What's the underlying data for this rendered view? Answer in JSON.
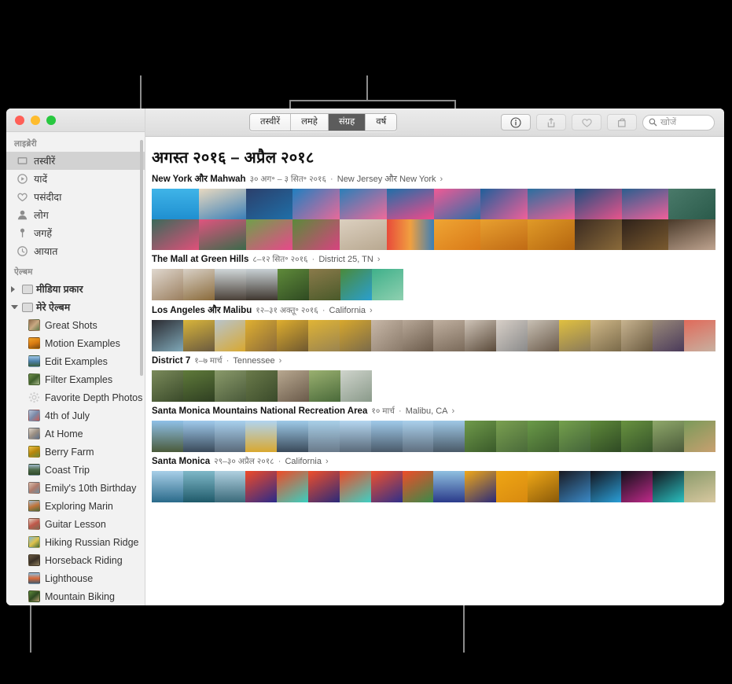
{
  "window": {
    "traffic_lights": [
      "close",
      "minimize",
      "zoom"
    ]
  },
  "sidebar": {
    "library_header": "लाइब्रेरी",
    "library_items": [
      {
        "label": "तस्वीरें",
        "icon": "photos-icon",
        "selected": true
      },
      {
        "label": "यादें",
        "icon": "memories-icon",
        "selected": false
      },
      {
        "label": "पसंदीदा",
        "icon": "heart-icon",
        "selected": false
      },
      {
        "label": "लोग",
        "icon": "person-icon",
        "selected": false
      },
      {
        "label": "जगहें",
        "icon": "pin-icon",
        "selected": false
      },
      {
        "label": "आयात",
        "icon": "clock-icon",
        "selected": false
      }
    ],
    "albums_header": "ऐल्बम",
    "groups": [
      {
        "label": "मीडिया प्रकार",
        "expanded": false
      },
      {
        "label": "मेरे ऐल्बम",
        "expanded": true
      }
    ],
    "albums": [
      {
        "label": "Great Shots",
        "thumb": "linear-gradient(135deg,#8d6b4c,#c9a882,#5e7a4a)"
      },
      {
        "label": "Motion Examples",
        "thumb": "linear-gradient(160deg,#f0a32b,#d97b12,#7a4a10)"
      },
      {
        "label": "Edit Examples",
        "thumb": "linear-gradient(180deg,#9fc6e8,#4a7fa8,#38603f)"
      },
      {
        "label": "Filter Examples",
        "thumb": "linear-gradient(140deg,#6f8f4a,#3f5f2c,#a8b88a)"
      },
      {
        "label": "Favorite Depth Photos",
        "thumb": "gear-icon"
      },
      {
        "label": "4th of July",
        "thumb": "linear-gradient(135deg,#b9c3d6,#7a8aa8,#c75b55)"
      },
      {
        "label": "At Home",
        "thumb": "linear-gradient(140deg,#dcd3c8,#9b8f82,#5c6f8a)"
      },
      {
        "label": "Berry Farm",
        "thumb": "linear-gradient(150deg,#e8c24a,#b8860b,#6d8a3a)"
      },
      {
        "label": "Coast Trip",
        "thumb": "linear-gradient(180deg,#9fb8c9,#4e6b4a,#2f4a2a)"
      },
      {
        "label": "Emily's 10th Birthday",
        "thumb": "linear-gradient(140deg,#d8c0b0,#b07a6a,#6f8f9f)"
      },
      {
        "label": "Exploring Marin",
        "thumb": "linear-gradient(160deg,#9fc2dc,#c1743a,#4a6a3a)"
      },
      {
        "label": "Guitar Lesson",
        "thumb": "linear-gradient(150deg,#e0d2c0,#c0584a,#7a6a52)"
      },
      {
        "label": "Hiking Russian Ridge",
        "thumb": "linear-gradient(140deg,#79b8e0,#e0c24a,#3f6a3a)"
      },
      {
        "label": "Horseback Riding",
        "thumb": "linear-gradient(150deg,#6b5a42,#3a3026,#8a7a5a)"
      },
      {
        "label": "Lighthouse",
        "thumb": "linear-gradient(180deg,#8fc0e0,#d96a3a,#4a5a6a)"
      },
      {
        "label": "Mountain Biking",
        "thumb": "linear-gradient(140deg,#5f8a3a,#2f4a22,#b8a070)"
      }
    ]
  },
  "toolbar": {
    "segments": [
      {
        "label": "तस्वीरें",
        "active": false
      },
      {
        "label": "लमहे",
        "active": false
      },
      {
        "label": "संग्रह",
        "active": true
      },
      {
        "label": "वर्ष",
        "active": false
      }
    ],
    "buttons": [
      {
        "name": "info-icon",
        "glyph": "ⓘ",
        "enabled": true
      },
      {
        "name": "share-icon",
        "glyph": "share",
        "enabled": false
      },
      {
        "name": "favorite-heart-icon",
        "glyph": "heart",
        "enabled": false
      },
      {
        "name": "rotate-icon",
        "glyph": "rotate",
        "enabled": false
      }
    ],
    "search_placeholder": "खोजें",
    "search_value": ""
  },
  "main": {
    "title": "अगस्त २०१६ – अप्रैल २०१८",
    "collections": [
      {
        "title": "New York और Mahwah",
        "date": "३० अग॰ – ३ सित॰ २०१६",
        "place": "New Jersey और New York",
        "rows": 2,
        "tiles": [
          "linear-gradient(180deg,#3fb4e8,#1f8fd0)",
          "linear-gradient(160deg,#e8d9c0,#3a7fb8)",
          "linear-gradient(150deg,#2b3f6b,#1f6fa8)",
          "linear-gradient(140deg,#1f7fc0,#e86a9a)",
          "linear-gradient(150deg,#2a7fb8,#f06a9a)",
          "linear-gradient(160deg,#1f6fa8,#f04a8a)",
          "linear-gradient(150deg,#f05a95,#2a6fa8)",
          "linear-gradient(140deg,#1f5f9a,#f0609a)",
          "linear-gradient(160deg,#2a6f9f,#ef5f95)",
          "linear-gradient(150deg,#1d4f7f,#e8548c)",
          "linear-gradient(160deg,#2b5f8f,#f0609a)",
          "linear-gradient(140deg,#4a7a6a,#2a5a4a)",
          "linear-gradient(150deg,#3a6a5a,#e0507a)",
          "linear-gradient(160deg,#e0547f,#3a6a4a)",
          "linear-gradient(150deg,#6fa04a,#e8488a)",
          "linear-gradient(140deg,#5a8a3a,#d8427f)",
          "linear-gradient(160deg,#dcd0c0,#b8a890)",
          "linear-gradient(90deg,#e84a3a,#f0a040,#3a7fb8)",
          "linear-gradient(150deg,#efa534,#d97a18)",
          "linear-gradient(160deg,#e8a030,#c06a14)",
          "linear-gradient(150deg,#e09a28,#b5660f)",
          "linear-gradient(140deg,#3a2a20,#8a6a3a)",
          "linear-gradient(150deg,#2e211a,#7a5a2f)",
          "linear-gradient(160deg,#4a3a2a,#bfa490)"
        ]
      },
      {
        "title": "The Mall at Green Hills",
        "date": "८–१२ सित॰ २०१६",
        "place": "District 25, TN",
        "rows": 1,
        "tiles": [
          "linear-gradient(150deg,#e0d8cf,#9b7f5f)",
          "linear-gradient(160deg,#d8d0c6,#8a6a3a)",
          "linear-gradient(180deg,#cfd6d8,#4a4038)",
          "linear-gradient(180deg,#c8d0d4,#3f372f)",
          "linear-gradient(150deg,#5f8a3a,#2f4a22)",
          "linear-gradient(160deg,#8a7a4a,#4a5a2a)",
          "linear-gradient(140deg,#4a8a3a,#2a9fd0)",
          "linear-gradient(150deg,#3fb08a,#8fd0b0)"
        ]
      },
      {
        "title": "Los Angeles और Malibu",
        "date": "१२–३१ अक्तू॰ २०१६",
        "place": "California",
        "rows": 1,
        "tiles": [
          "linear-gradient(150deg,#2a2a30,#7fa8b8)",
          "linear-gradient(160deg,#d8b43a,#6a5a40)",
          "linear-gradient(150deg,#b8c4cc,#d8a830)",
          "linear-gradient(140deg,#e0b030,#8a6a3a)",
          "linear-gradient(150deg,#dfae2e,#6f5830)",
          "linear-gradient(160deg,#e0b435,#9a8450)",
          "linear-gradient(150deg,#d8a82c,#7a6a4a)",
          "linear-gradient(140deg,#c8b8a8,#8a7a6a)",
          "linear-gradient(150deg,#b8a898,#6a5a4a)",
          "linear-gradient(160deg,#c0b0a0,#7a6a5a)",
          "linear-gradient(150deg,#cfc4b8,#5a4a3a)",
          "linear-gradient(140deg,#d8d0c8,#8a8a8a)",
          "linear-gradient(150deg,#c8c0b4,#6a5a4a)",
          "linear-gradient(160deg,#e0c040,#8a7a5a)",
          "linear-gradient(150deg,#d0b888,#7a6a4a)",
          "linear-gradient(140deg,#c8b490,#6a5a40)",
          "linear-gradient(150deg,#9a8a7a,#4a3a5a)",
          "linear-gradient(160deg,#e06a5a,#c8b0a0)"
        ]
      },
      {
        "title": "District 7",
        "date": "१–७ मार्च",
        "place": "Tennessee",
        "rows": 1,
        "tiles": [
          "linear-gradient(150deg,#7a8a5a,#3a4a2a)",
          "linear-gradient(160deg,#5f7a3a,#2f3f22)",
          "linear-gradient(150deg,#8a9a6a,#4a5a3a)",
          "linear-gradient(140deg,#6a7a4a,#3a4a2a)",
          "linear-gradient(150deg,#b8a890,#6a5a4a)",
          "linear-gradient(160deg,#9ab070,#4a6a3a)",
          "linear-gradient(150deg,#cfd4cc,#8a9a8a)"
        ]
      },
      {
        "title": "Santa Monica Mountains National Recreation Area",
        "date": "१० मार्च",
        "place": "Malibu, CA",
        "rows": 1,
        "tiles": [
          "linear-gradient(180deg,#8fc0e8,#4a5a3a)",
          "linear-gradient(180deg,#9fcaec,#3a4a5a)",
          "linear-gradient(180deg,#a8d0ee,#5a6a7a)",
          "linear-gradient(180deg,#b0d4f0,#d8a830)",
          "linear-gradient(180deg,#9ecae8,#3a4a5a)",
          "linear-gradient(180deg,#a8cfe8,#6a7a8a)",
          "linear-gradient(180deg,#b4d6f0,#5a6a7a)",
          "linear-gradient(180deg,#a0caea,#4a5a6a)",
          "linear-gradient(180deg,#aad0ec,#5f6f7f)",
          "linear-gradient(180deg,#9fc8e6,#4a5a68)",
          "linear-gradient(150deg,#6f9a4a,#3a5a2a)",
          "linear-gradient(150deg,#7aa050,#4a6a3a)",
          "linear-gradient(150deg,#6a9a48,#3f5f2f)",
          "linear-gradient(150deg,#74a04c,#44643a)",
          "linear-gradient(150deg,#5f8a3a,#2f4a24)",
          "linear-gradient(150deg,#68923f,#36542a)",
          "linear-gradient(160deg,#8fa86a,#4a5a3a)",
          "linear-gradient(150deg,#7a9a5a,#c8a070)"
        ]
      },
      {
        "title": "Santa Monica",
        "date": "२९–३० अप्रैल २०१८",
        "place": "California",
        "rows": 1,
        "tiles": [
          "linear-gradient(180deg,#a8cfe8,#2a6a8a)",
          "linear-gradient(180deg,#7fb8c8,#1f5a6a)",
          "linear-gradient(180deg,#b0d0e0,#3a6a7a)",
          "linear-gradient(150deg,#f04a28,#2a2a8a)",
          "linear-gradient(150deg,#ef4a26,#3ad0c0)",
          "linear-gradient(150deg,#f04e2a,#2a2a7a)",
          "linear-gradient(150deg,#ee4a26,#3fd0c4)",
          "linear-gradient(150deg,#f0502c,#2f2f8a)",
          "linear-gradient(150deg,#ef4c28,#3a8a4a)",
          "linear-gradient(180deg,#8fc0e0,#2a3a8a)",
          "linear-gradient(150deg,#f0a818,#2a2a7a)",
          "linear-gradient(150deg,#efa614,#d88a10)",
          "linear-gradient(150deg,#f0a816,#8a5a0a)",
          "linear-gradient(150deg,#1a1a22,#3a8ac8)",
          "linear-gradient(150deg,#14141c,#2a9fd8)",
          "linear-gradient(150deg,#101018,#c02a8a)",
          "linear-gradient(150deg,#12121a,#2ac0c0)",
          "linear-gradient(160deg,#8a9a6a,#d8c8a0)"
        ]
      }
    ]
  }
}
